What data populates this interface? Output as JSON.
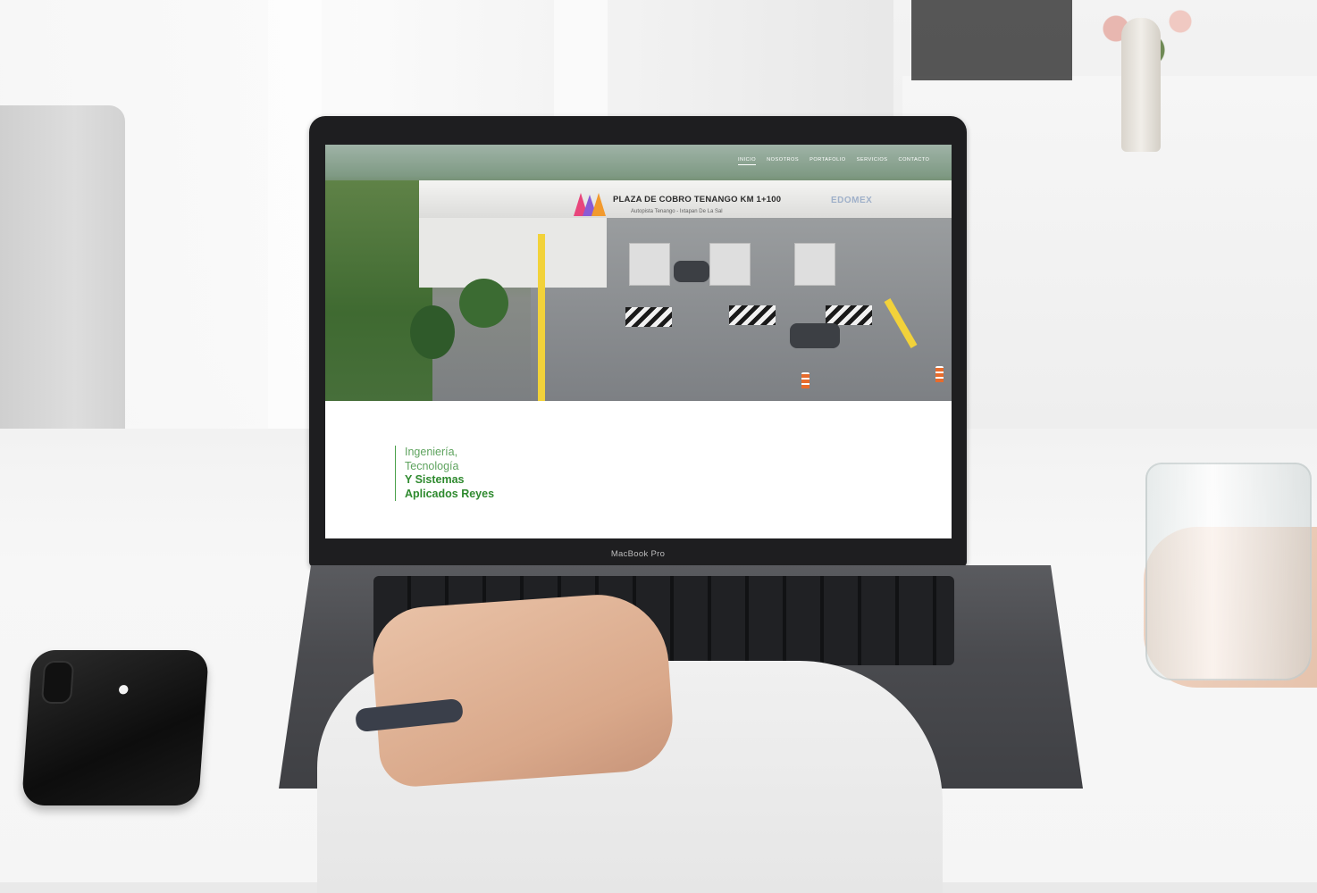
{
  "laptop": {
    "brand_label": "MacBook Pro"
  },
  "website": {
    "nav": {
      "items": [
        {
          "label": "INICIO",
          "active": true
        },
        {
          "label": "NOSOTROS",
          "active": false
        },
        {
          "label": "PORTAFOLIO",
          "active": false
        },
        {
          "label": "SERVICIOS",
          "active": false
        },
        {
          "label": "CONTACTO",
          "active": false
        }
      ]
    },
    "hero": {
      "sign_title": "PLAZA DE COBRO TENANGO KM 1+100",
      "sign_subtitle": "Autopista Tenango - Ixtapan De La Sal",
      "sign_brand": "EDOMEX"
    },
    "tagline": {
      "line1": "Ingeniería,",
      "line2": "Tecnología",
      "line3": "Y Sistemas",
      "line4": "Aplicados Reyes"
    },
    "colors": {
      "accent_green": "#2f8a2f",
      "accent_light_green": "#5ea35e"
    }
  },
  "phone": {
    "logo_icon": "apple-logo-icon"
  }
}
